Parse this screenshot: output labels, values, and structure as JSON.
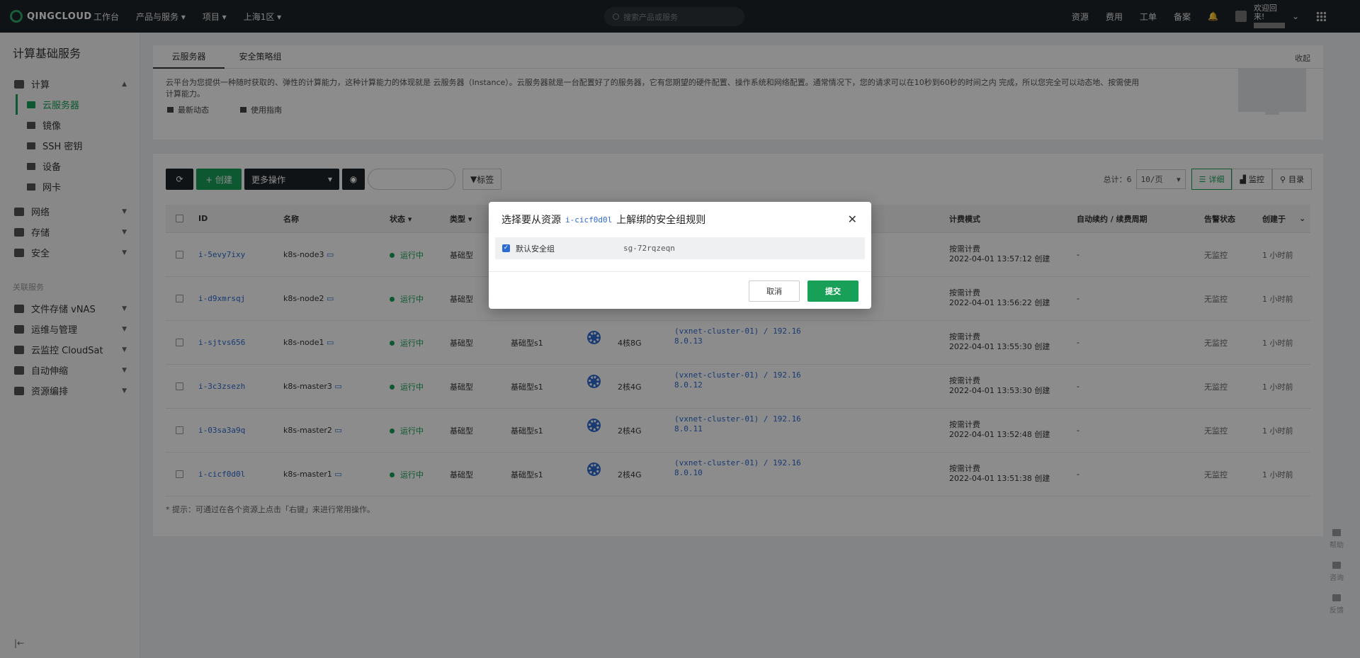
{
  "topbar": {
    "logo_text": "QINGCLOUD",
    "nav": [
      "工作台",
      "产品与服务 ▾",
      "项目 ▾",
      "上海1区 ▾"
    ],
    "search_placeholder": "搜索产品或服务",
    "right": [
      "资源",
      "费用",
      "工单",
      "备案"
    ],
    "welcome": "欢迎回来!"
  },
  "sidebar": {
    "title": "计算基础服务",
    "compute_label": "计算",
    "compute_items": [
      "云服务器",
      "镜像",
      "SSH 密钥",
      "设备",
      "网卡"
    ],
    "groups": [
      "网络",
      "存储",
      "安全"
    ],
    "section_label": "关联服务",
    "related": [
      "文件存储 vNAS",
      "运维与管理",
      "云监控 CloudSat",
      "自动伸缩",
      "资源编排"
    ],
    "bottom": "|←"
  },
  "info": {
    "tabs": [
      "云服务器",
      "安全策略组"
    ],
    "collapse": "收起",
    "description": "云平台为您提供一种随时获取的、弹性的计算能力，这种计算能力的体现就是 云服务器（Instance）。云服务器就是一台配置好了的服务器，它有您期望的硬件配置、操作系统和网络配置。通常情况下，您的请求可以在10秒到60秒的时间之内 完成，所以您完全可以动态地、按需使用计算能力。",
    "links": [
      "最新动态",
      "使用指南"
    ]
  },
  "toolbar": {
    "refresh": "⟳",
    "create": "+ 创建",
    "more": "更多操作",
    "tag": "标签",
    "total": "总计：6",
    "per_page": "10/页",
    "views": [
      "详细",
      "监控",
      "目录"
    ]
  },
  "table": {
    "headers": [
      "ID",
      "名称",
      "状态 ▾",
      "类型 ▾",
      "计费模式",
      "自动续约 / 续费周期",
      "告警状态",
      "创建于"
    ],
    "rows": [
      {
        "id": "i-5evy7ixy",
        "name": "k8s-node3",
        "status": "运行中",
        "type": "基础型",
        "cls": "",
        "spec": "",
        "net1": "",
        "net2": "",
        "billing": "按需计费",
        "created_at": "2022-04-01 13:57:12 创建",
        "renew": "-",
        "alarm": "无监控",
        "age": "1 小时前"
      },
      {
        "id": "i-d9xmrsqj",
        "name": "k8s-node2",
        "status": "运行中",
        "type": "基础型",
        "cls": "",
        "spec": "",
        "net1": "",
        "net2": "",
        "billing": "按需计费",
        "created_at": "2022-04-01 13:56:22 创建",
        "renew": "-",
        "alarm": "无监控",
        "age": "1 小时前"
      },
      {
        "id": "i-sjtvs656",
        "name": "k8s-node1",
        "status": "运行中",
        "type": "基础型",
        "cls": "基础型s1",
        "spec": "4核8G",
        "net1": "(vxnet-cluster-01) / 192.16",
        "net2": "8.0.13",
        "billing": "按需计费",
        "created_at": "2022-04-01 13:55:30 创建",
        "renew": "-",
        "alarm": "无监控",
        "age": "1 小时前"
      },
      {
        "id": "i-3c3zsezh",
        "name": "k8s-master3",
        "status": "运行中",
        "type": "基础型",
        "cls": "基础型s1",
        "spec": "2核4G",
        "net1": "(vxnet-cluster-01) / 192.16",
        "net2": "8.0.12",
        "billing": "按需计费",
        "created_at": "2022-04-01 13:53:30 创建",
        "renew": "-",
        "alarm": "无监控",
        "age": "1 小时前"
      },
      {
        "id": "i-03sa3a9q",
        "name": "k8s-master2",
        "status": "运行中",
        "type": "基础型",
        "cls": "基础型s1",
        "spec": "2核4G",
        "net1": "(vxnet-cluster-01) / 192.16",
        "net2": "8.0.11",
        "billing": "按需计费",
        "created_at": "2022-04-01 13:52:48 创建",
        "renew": "-",
        "alarm": "无监控",
        "age": "1 小时前"
      },
      {
        "id": "i-cicf0d0l",
        "name": "k8s-master1",
        "status": "运行中",
        "type": "基础型",
        "cls": "基础型s1",
        "spec": "2核4G",
        "net1": "(vxnet-cluster-01) / 192.16",
        "net2": "8.0.10",
        "billing": "按需计费",
        "created_at": "2022-04-01 13:51:38 创建",
        "renew": "-",
        "alarm": "无监控",
        "age": "1 小时前"
      }
    ],
    "hint": "* 提示：可通过在各个资源上点击「右键」来进行常用操作。"
  },
  "float": [
    "帮助",
    "咨询",
    "反馈"
  ],
  "modal": {
    "title_prefix": "选择要从资源",
    "resource_id": "i-cicf0d0l",
    "title_suffix": "上解绑的安全组规则",
    "group_name": "默认安全组",
    "group_id": "sg-72rqzeqn",
    "cancel": "取消",
    "submit": "提交"
  }
}
